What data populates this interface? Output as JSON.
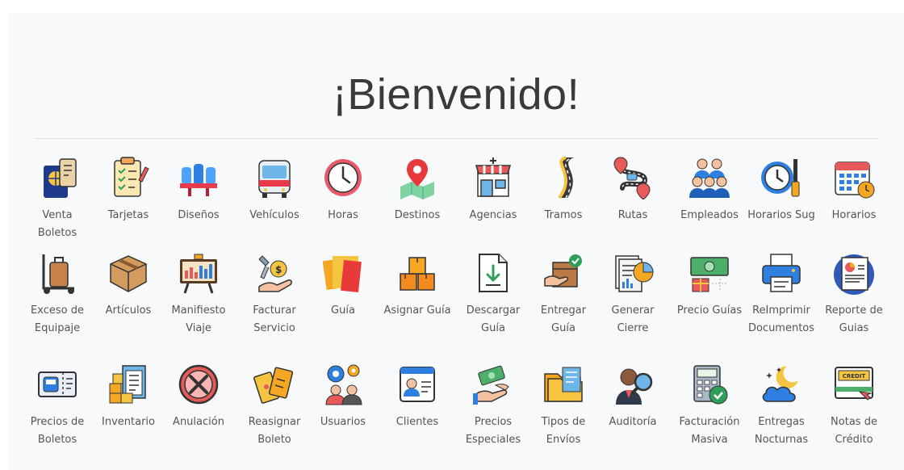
{
  "page": {
    "title": "¡Bienvenido!"
  },
  "rows": [
    [
      {
        "label": "Venta Boletos",
        "icon": "passport-icon"
      },
      {
        "label": "Tarjetas",
        "icon": "checklist-icon"
      },
      {
        "label": "Diseños",
        "icon": "seats-icon"
      },
      {
        "label": "Vehículos",
        "icon": "bus-icon"
      },
      {
        "label": "Horas",
        "icon": "clock-icon"
      },
      {
        "label": "Destinos",
        "icon": "map-pin-icon"
      },
      {
        "label": "Agencias",
        "icon": "store-icon"
      },
      {
        "label": "Tramos",
        "icon": "road-icon"
      },
      {
        "label": "Rutas",
        "icon": "route-icon"
      },
      {
        "label": "Empleados",
        "icon": "team-icon"
      },
      {
        "label": "Horarios Sug",
        "icon": "clock-tools-icon"
      },
      {
        "label": "Horarios",
        "icon": "calendar-icon"
      }
    ],
    [
      {
        "label": "Exceso de Equipaje",
        "icon": "luggage-cart-icon"
      },
      {
        "label": "Artículos",
        "icon": "box-icon"
      },
      {
        "label": "Manifiesto Viaje",
        "icon": "presentation-board-icon"
      },
      {
        "label": "Facturar Servicio",
        "icon": "service-billing-icon"
      },
      {
        "label": "Guía",
        "icon": "notes-icon"
      },
      {
        "label": "Asignar Guía",
        "icon": "stacked-boxes-icon"
      },
      {
        "label": "Descargar Guía",
        "icon": "download-document-icon"
      },
      {
        "label": "Entregar Guía",
        "icon": "package-delivery-icon"
      },
      {
        "label": "Generar Cierre",
        "icon": "report-chart-icon"
      },
      {
        "label": "Precio Guías",
        "icon": "money-gift-icon"
      },
      {
        "label": "ReImprimir Documentos",
        "icon": "printer-icon"
      },
      {
        "label": "Reporte de Guias",
        "icon": "report-icon"
      }
    ],
    [
      {
        "label": "Precios de Boletos",
        "icon": "bus-ticket-icon"
      },
      {
        "label": "Inventario",
        "icon": "inventory-icon"
      },
      {
        "label": "Anulación",
        "icon": "cancel-icon"
      },
      {
        "label": "Reasignar Boleto",
        "icon": "tickets-icon"
      },
      {
        "label": "Usuarios",
        "icon": "users-gear-icon"
      },
      {
        "label": "Clientes",
        "icon": "id-card-icon"
      },
      {
        "label": "Precios Especiales",
        "icon": "money-hand-icon"
      },
      {
        "label": "Tipos de Envíos",
        "icon": "folders-icon"
      },
      {
        "label": "Auditoría",
        "icon": "auditor-icon"
      },
      {
        "label": "Facturación Masiva",
        "icon": "calculator-icon"
      },
      {
        "label": "Entregas Nocturnas",
        "icon": "night-cloud-icon"
      },
      {
        "label": "Notas de Crédito",
        "icon": "credit-note-icon"
      }
    ]
  ],
  "labels": {
    "credit": "CREDIT"
  }
}
